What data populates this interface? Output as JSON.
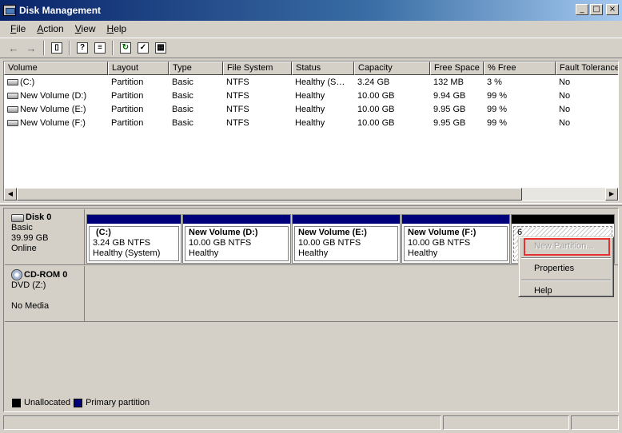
{
  "window": {
    "title": "Disk Management"
  },
  "menu": [
    "File",
    "Action",
    "View",
    "Help"
  ],
  "volume_list": {
    "columns": [
      "Volume",
      "Layout",
      "Type",
      "File System",
      "Status",
      "Capacity",
      "Free Space",
      "% Free",
      "Fault Tolerance"
    ],
    "rows": [
      [
        "(C:)",
        "Partition",
        "Basic",
        "NTFS",
        "Healthy (S…",
        "3.24 GB",
        "132 MB",
        "3 %",
        "No"
      ],
      [
        "New Volume (D:)",
        "Partition",
        "Basic",
        "NTFS",
        "Healthy",
        "10.00 GB",
        "9.94 GB",
        "99 %",
        "No"
      ],
      [
        "New Volume (E:)",
        "Partition",
        "Basic",
        "NTFS",
        "Healthy",
        "10.00 GB",
        "9.95 GB",
        "99 %",
        "No"
      ],
      [
        "New Volume (F:)",
        "Partition",
        "Basic",
        "NTFS",
        "Healthy",
        "10.00 GB",
        "9.95 GB",
        "99 %",
        "No"
      ]
    ]
  },
  "disks": [
    {
      "name": "Disk 0",
      "type": "Basic",
      "size": "39.99 GB",
      "state": "Online",
      "partitions": [
        {
          "name": "(C:)",
          "size": "3.24 GB NTFS",
          "status": "Healthy (System)"
        },
        {
          "name": "New Volume  (D:)",
          "size": "10.00 GB NTFS",
          "status": "Healthy"
        },
        {
          "name": "New Volume  (E:)",
          "size": "10.00 GB NTFS",
          "status": "Healthy"
        },
        {
          "name": "New Volume  (F:)",
          "size": "10.00 GB NTFS",
          "status": "Healthy"
        },
        {
          "name": "",
          "size": "6",
          "status": "U"
        }
      ]
    }
  ],
  "cdrom": {
    "name": "CD-ROM 0",
    "drive": "DVD (Z:)",
    "media": "No Media"
  },
  "legend": {
    "unallocated": "Unallocated",
    "primary": "Primary partition"
  },
  "context_menu": {
    "items": [
      "New Partition...",
      "Properties",
      "Help"
    ]
  },
  "colors": {
    "primary_partition": "#00007b",
    "unallocated": "#000000",
    "highlight": "#e83030"
  }
}
